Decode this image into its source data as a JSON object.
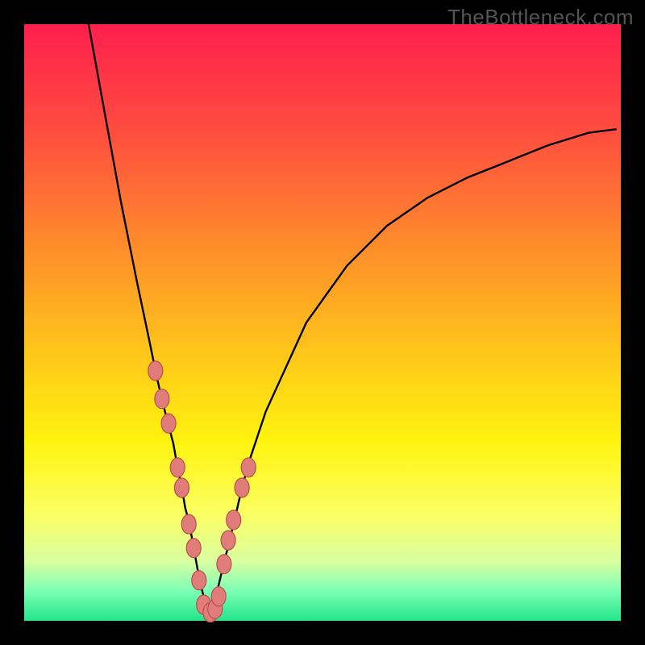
{
  "watermark": "TheBottleneck.com",
  "colors": {
    "frame": "#000000",
    "marker_fill": "#e07c79",
    "marker_stroke": "#b84f4c",
    "curve": "#000000"
  },
  "chart_data": {
    "type": "line",
    "title": "",
    "xlabel": "",
    "ylabel": "",
    "xlim": [
      0,
      100
    ],
    "ylim": [
      0,
      100
    ],
    "note": "No axes, ticks, or legend are shown. Curve is a smooth V-shaped black line on a rainbow vertical gradient. Coral oval markers cluster near the valley on both arms. Values estimated from pixel positions.",
    "series": [
      {
        "name": "curve",
        "x": [
          10.8,
          13.5,
          16.2,
          18.9,
          20.9,
          22.3,
          23.6,
          25.0,
          25.7,
          26.4,
          27.0,
          27.7,
          28.4,
          29.4,
          30.4,
          31.1,
          31.8,
          33.1,
          35.1,
          36.5,
          37.8,
          40.5,
          47.3,
          54.1,
          60.8,
          67.6,
          74.3,
          81.1,
          87.8,
          94.6,
          99.3
        ],
        "y": [
          100.0,
          85.1,
          70.3,
          56.8,
          47.3,
          40.5,
          35.1,
          29.7,
          25.7,
          22.3,
          18.9,
          16.2,
          12.2,
          6.8,
          2.7,
          1.4,
          2.7,
          8.1,
          16.2,
          22.3,
          27.0,
          35.1,
          50.0,
          59.5,
          66.2,
          70.9,
          74.3,
          77.0,
          79.7,
          81.8,
          82.4
        ]
      }
    ],
    "markers": {
      "name": "highlight-points",
      "x": [
        22.0,
        23.1,
        24.2,
        25.7,
        26.4,
        27.6,
        28.4,
        29.3,
        30.1,
        31.2,
        32.0,
        32.6,
        33.5,
        34.2,
        35.1,
        36.5,
        37.6
      ],
      "y": [
        41.9,
        37.2,
        33.1,
        25.7,
        22.3,
        16.2,
        12.2,
        6.8,
        2.7,
        1.4,
        2.0,
        4.1,
        9.5,
        13.5,
        16.9,
        22.3,
        25.7
      ]
    },
    "gradient_stops": [
      {
        "pos": 0.0,
        "color": "#ff1f4e"
      },
      {
        "pos": 0.18,
        "color": "#ff4d3f"
      },
      {
        "pos": 0.38,
        "color": "#ff8f2a"
      },
      {
        "pos": 0.55,
        "color": "#ffc61a"
      },
      {
        "pos": 0.7,
        "color": "#fff30f"
      },
      {
        "pos": 0.82,
        "color": "#fcff62"
      },
      {
        "pos": 0.9,
        "color": "#d9ffa0"
      },
      {
        "pos": 0.95,
        "color": "#7dffb5"
      },
      {
        "pos": 1.0,
        "color": "#22e58a"
      }
    ]
  }
}
